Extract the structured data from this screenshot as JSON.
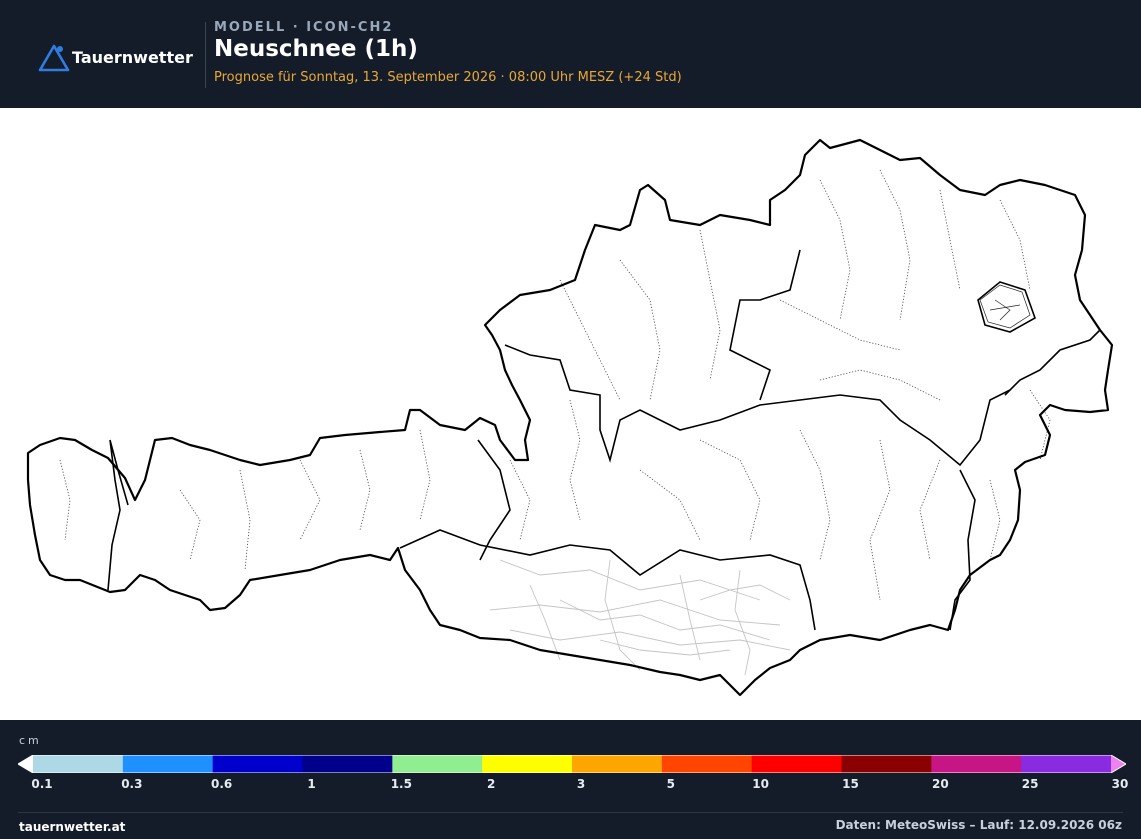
{
  "header": {
    "logo_text": "Tauernwetter",
    "model_label": "MODELL · ICON-CH2",
    "title": "Neuschnee (1h)",
    "subtitle": "Prognose für Sonntag, 13. September 2026 · 08:00 Uhr MESZ  (+24 Std)"
  },
  "map": {
    "region": "Austria",
    "layers": [
      "country-border",
      "state-borders",
      "district-borders",
      "lines-carinthia"
    ]
  },
  "legend": {
    "unit": "cm",
    "ticks": [
      "0.1",
      "0.3",
      "0.6",
      "1",
      "1.5",
      "2",
      "3",
      "5",
      "10",
      "15",
      "20",
      "25",
      "30"
    ],
    "colors": [
      "#add8e6",
      "#1e90ff",
      "#0000cd",
      "#00008b",
      "#90ee90",
      "#ffff00",
      "#ffa500",
      "#ff4500",
      "#ff0000",
      "#8b0000",
      "#c71585",
      "#8a2be2"
    ],
    "under_color": "#ffffff",
    "over_color": "#ee82ee"
  },
  "footer": {
    "site": "tauernwetter.at",
    "source": "Daten: MeteoSwiss – Lauf: 12.09.2026 06z"
  }
}
